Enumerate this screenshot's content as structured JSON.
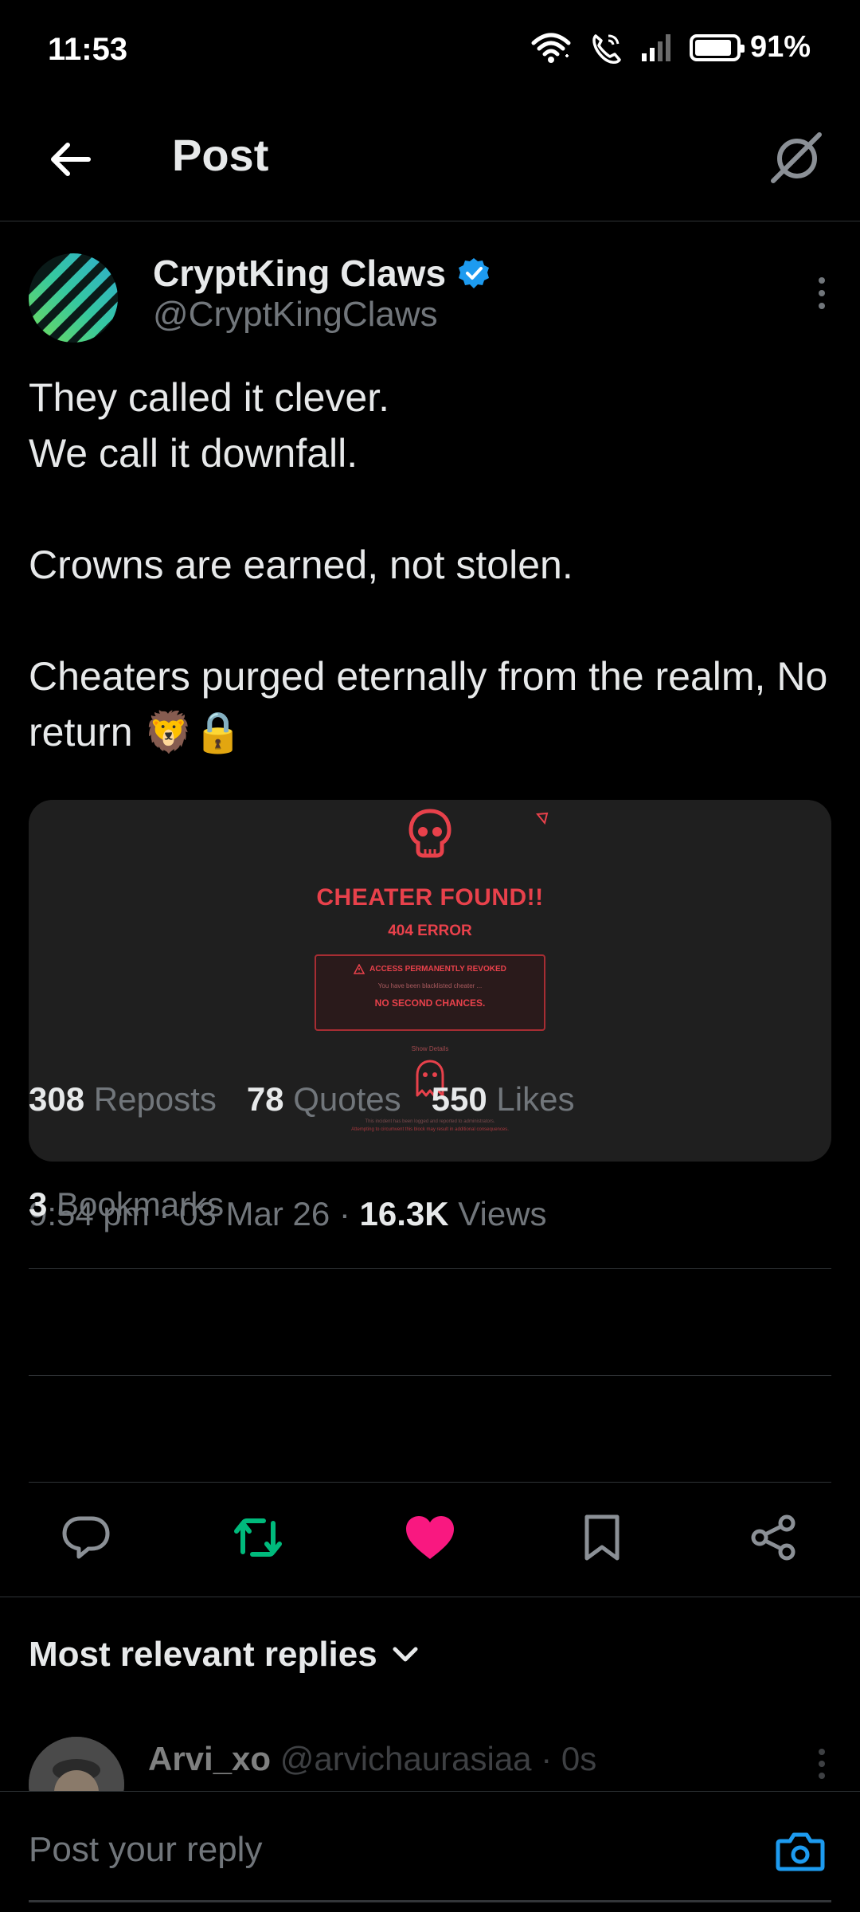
{
  "status_bar": {
    "time": "11:53",
    "battery_percent": "91%",
    "battery_level": 0.91,
    "icons": [
      "wifi-icon",
      "wifi-call-icon",
      "signal-icon",
      "battery-icon"
    ]
  },
  "header": {
    "title": "Post",
    "back_icon": "arrow-left-icon",
    "grok_icon": "grok-icon"
  },
  "post": {
    "author_name": "CryptKing Claws",
    "verified": true,
    "handle": "@CryptKingClaws",
    "text": "They called it clever.\nWe call it downfall.\n\nCrowns are earned, not stolen.\n\nCheaters purged eternally from the realm, No return 🦁🔒",
    "media": {
      "title": "CHEATER FOUND!!",
      "code": "404 ERROR",
      "box_heading": "ACCESS PERMANENTLY REVOKED",
      "box_sub": "You have been blacklisted cheater ...",
      "box_note": "NO SECOND CHANCES.",
      "show_details": "Show Details",
      "footer_1": "This incident has been logged and reported to administrators.",
      "footer_2": "Attempting to circumvent this block may result in additional consequences."
    },
    "time": "9:54 pm",
    "date": "03 Mar 26",
    "views_count": "16.3K",
    "views_label": "Views",
    "reposts_count": "308",
    "reposts_label": "Reposts",
    "quotes_count": "78",
    "quotes_label": "Quotes",
    "likes_count": "550",
    "likes_label": "Likes",
    "bookmarks_count": "3",
    "bookmarks_label": "Bookmarks"
  },
  "actions": {
    "reply_icon": "reply-icon",
    "repost_icon": "repost-icon",
    "like_icon": "heart-icon",
    "bookmark_icon": "bookmark-icon",
    "share_icon": "share-icon",
    "repost_color": "#00ba7c",
    "like_color": "#f91880"
  },
  "replies": {
    "sort_label": "Most relevant replies",
    "items": [
      {
        "name": "Arvi_xo",
        "handle": "@arvichaurasiaa",
        "time": "0s"
      }
    ]
  },
  "composer": {
    "placeholder": "Post your reply",
    "camera_icon": "camera-icon"
  },
  "colors": {
    "accent": "#1d9bf0",
    "error_red": "#e8414b",
    "background": "#000000",
    "secondary_text": "#71767b"
  }
}
